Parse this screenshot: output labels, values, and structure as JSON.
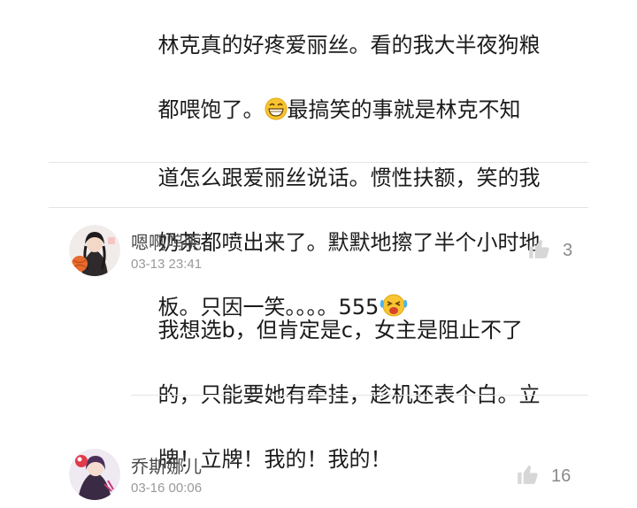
{
  "previous_comment": {
    "lines": [
      "林克真的好疼爱丽丝。看的我大半夜狗粮",
      "都喂饱了。",
      "最搞笑的事就是林克不知",
      "道怎么跟爱丽丝说话。惯性扶额，笑的我",
      "奶茶都喷出来了。默默地擦了半个小时地",
      "板。只因一笑。。。。555"
    ],
    "emojis": [
      "grin-emoji",
      "laugh-cry-emoji"
    ]
  },
  "comments": [
    {
      "username": "嗯啊呜呃",
      "timestamp": "03-13 23:41",
      "likes": "3",
      "lines": [
        "我想选b，但肯定是c，女主是阻止不了",
        "的，只能要她有牵挂，趁机还表个白。立",
        "牌！立牌！我的！我的！"
      ]
    },
    {
      "username": "乔斯娜儿",
      "timestamp": "03-16 00:06",
      "likes": "16"
    }
  ],
  "icons": {
    "like": "thumbs-up-icon"
  }
}
